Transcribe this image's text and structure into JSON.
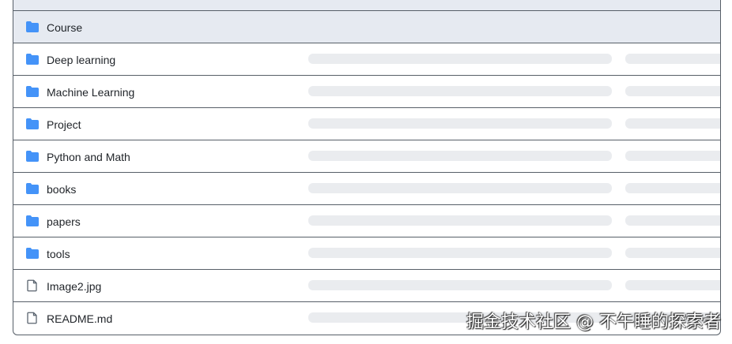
{
  "file_list": {
    "rows": [
      {
        "type": "folder",
        "name": "Course",
        "icon": "folder-icon",
        "highlighted": true
      },
      {
        "type": "folder",
        "name": "Deep learning",
        "icon": "folder-icon"
      },
      {
        "type": "folder",
        "name": "Machine Learning",
        "icon": "folder-icon"
      },
      {
        "type": "folder",
        "name": "Project",
        "icon": "folder-icon"
      },
      {
        "type": "folder",
        "name": "Python and Math",
        "icon": "folder-icon"
      },
      {
        "type": "folder",
        "name": "books",
        "icon": "folder-icon"
      },
      {
        "type": "folder",
        "name": "papers",
        "icon": "folder-icon"
      },
      {
        "type": "folder",
        "name": "tools",
        "icon": "folder-icon"
      },
      {
        "type": "file",
        "name": "Image2.jpg",
        "icon": "file-icon"
      },
      {
        "type": "file",
        "name": "README.md",
        "icon": "file-icon"
      }
    ]
  },
  "watermark": {
    "text": "掘金技术社区 @ 不午睡的探索者"
  },
  "colors": {
    "folder": "#4493f8",
    "file": "#59636e",
    "highlight_bg": "#e6eaf1",
    "skeleton": "#eaecef",
    "border": "#575f68",
    "text": "#1f2328"
  }
}
